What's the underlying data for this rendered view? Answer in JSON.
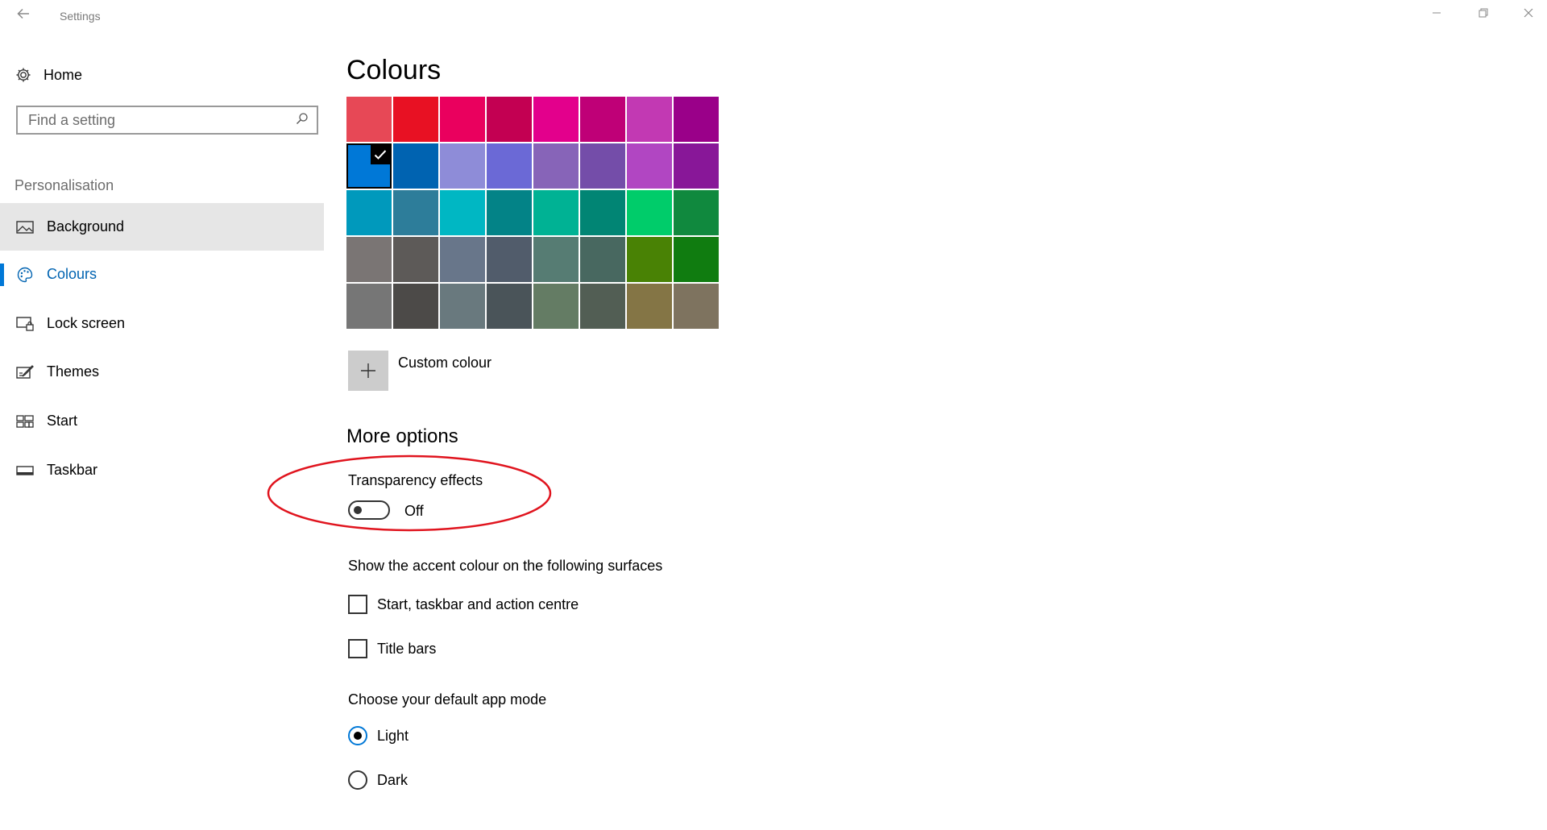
{
  "window": {
    "title": "Settings",
    "back_icon": "back-arrow-icon",
    "controls": [
      "minimize-icon",
      "restore-icon",
      "close-icon"
    ]
  },
  "sidebar": {
    "home_label": "Home",
    "search": {
      "placeholder": "Find a setting",
      "value": ""
    },
    "section_label": "Personalisation",
    "items": [
      {
        "label": "Background",
        "icon": "picture-icon",
        "state": "hover"
      },
      {
        "label": "Colours",
        "icon": "palette-icon",
        "state": "selected"
      },
      {
        "label": "Lock screen",
        "icon": "lock-screen-icon",
        "state": ""
      },
      {
        "label": "Themes",
        "icon": "themes-brush-icon",
        "state": ""
      },
      {
        "label": "Start",
        "icon": "start-tiles-icon",
        "state": ""
      },
      {
        "label": "Taskbar",
        "icon": "taskbar-icon",
        "state": ""
      }
    ]
  },
  "main": {
    "title": "Colours",
    "selected_accent": "#0078d7",
    "swatches": [
      "#e74856",
      "#e81123",
      "#ea005e",
      "#c30052",
      "#e3008c",
      "#bf0077",
      "#c239b3",
      "#9a0089",
      "#0078d7",
      "#0063b1",
      "#8e8cd8",
      "#6b69d6",
      "#8764b8",
      "#744da9",
      "#b146c2",
      "#881798",
      "#0099bc",
      "#2d7d9a",
      "#00b7c3",
      "#038387",
      "#00b294",
      "#018574",
      "#00cc6a",
      "#10893e",
      "#7a7574",
      "#5d5a58",
      "#68768a",
      "#515c6b",
      "#567c73",
      "#486860",
      "#498205",
      "#107c10",
      "#767676",
      "#4c4a48",
      "#69797e",
      "#4a5459",
      "#647c64",
      "#525e54",
      "#847545",
      "#7e735f"
    ],
    "custom_colour_label": "Custom colour",
    "more_options_label": "More options",
    "transparency": {
      "label": "Transparency effects",
      "state_label": "Off",
      "on": false,
      "highlight_color": "#e0141e"
    },
    "accent_surfaces": {
      "label": "Show the accent colour on the following surfaces",
      "options": [
        {
          "label": "Start, taskbar and action centre",
          "checked": false
        },
        {
          "label": "Title bars",
          "checked": false
        }
      ]
    },
    "app_mode": {
      "label": "Choose your default app mode",
      "options": [
        {
          "label": "Light",
          "checked": true
        },
        {
          "label": "Dark",
          "checked": false
        }
      ]
    }
  }
}
